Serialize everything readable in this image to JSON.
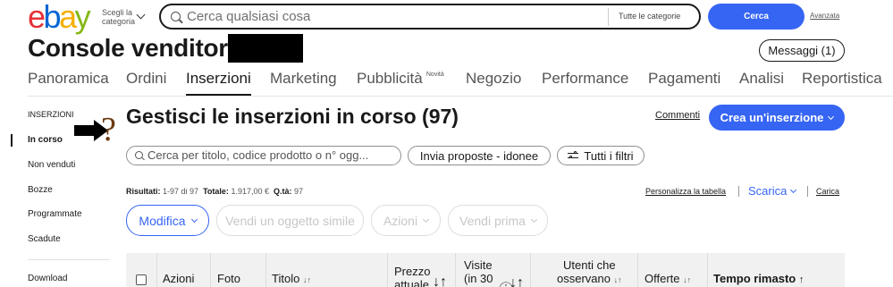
{
  "header": {
    "logo_letters": [
      {
        "ch": "e",
        "color": "#e53238"
      },
      {
        "ch": "b",
        "color": "#0064d2"
      },
      {
        "ch": "a",
        "color": "#f5af02"
      },
      {
        "ch": "y",
        "color": "#86b817"
      }
    ],
    "shop_by_category": "Scegli la categoria",
    "search_placeholder": "Cerca qualsiasi cosa",
    "category_select": "Tutte le categorie",
    "search_button": "Cerca",
    "advanced_link": "Avanzata"
  },
  "page_title": "Console venditori",
  "messages_button": "Messaggi (1)",
  "tabs": [
    {
      "label": "Panoramica",
      "active": false
    },
    {
      "label": "Ordini",
      "active": false
    },
    {
      "label": "Inserzioni",
      "active": true
    },
    {
      "label": "Marketing",
      "active": false
    },
    {
      "label": "Pubblicità",
      "active": false,
      "badge": "Novità"
    },
    {
      "label": "Negozio",
      "active": false
    },
    {
      "label": "Performance",
      "active": false
    },
    {
      "label": "Pagamenti",
      "active": false
    },
    {
      "label": "Analisi",
      "active": false
    },
    {
      "label": "Reportistica",
      "active": false
    }
  ],
  "sidebar": {
    "heading": "INSERZIONI",
    "items": [
      {
        "label": "In corso",
        "active": true
      },
      {
        "label": "Non venduti",
        "active": false
      },
      {
        "label": "Bozze",
        "active": false
      },
      {
        "label": "Programmate",
        "active": false
      },
      {
        "label": "Scadute",
        "active": false
      }
    ],
    "download": "Download"
  },
  "annotation": {
    "question_mark": "?"
  },
  "content": {
    "title": "Gestisci le inserzioni in corso (97)",
    "comments_link": "Commenti",
    "create_button": "Crea un'inserzione",
    "search_placeholder": "Cerca per titolo, codice prodotto o n° ogg...",
    "proposals_pill": "Invia proposte - idonee",
    "filters_pill": "Tutti i filtri",
    "summary": {
      "results_label": "Risultati:",
      "results_value": "1-97 di 97",
      "total_label": "Totale:",
      "total_value": "1.917,00 €",
      "qty_label": "Q.tà:",
      "qty_value": "97"
    },
    "customize_table": "Personalizza la tabella",
    "download_menu": "Scarica",
    "upload_link": "Carica",
    "actions": {
      "edit": "Modifica",
      "sell_similar": "Vendi un oggetto simile",
      "actions": "Azioni",
      "sell_first": "Vendi prima"
    },
    "table_headers": {
      "actions": "Azioni",
      "photo": "Foto",
      "title": "Titolo",
      "price_1": "Prezzo",
      "price_2": "attuale",
      "visits_1": "Visite",
      "visits_2": "(in 30",
      "watchers_1": "Utenti che",
      "watchers_2": "osservano",
      "offers": "Offerte",
      "time_left": "Tempo rimasto"
    }
  },
  "colors": {
    "accent": "#3665f3",
    "text": "#191919",
    "annotation_arrow": "#000000",
    "annotation_question": "#6b3a10"
  }
}
